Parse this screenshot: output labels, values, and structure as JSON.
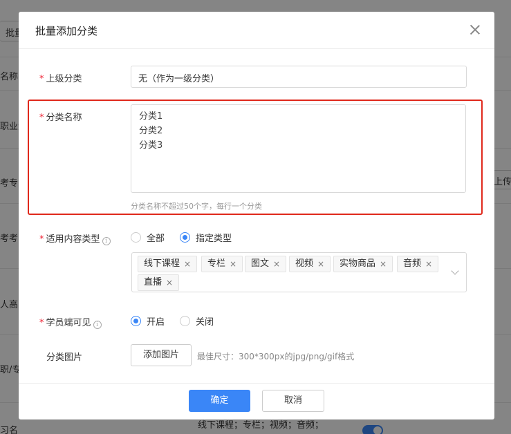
{
  "background": {
    "texts": [
      "批量",
      "名称",
      "职业资",
      "考专",
      "考考",
      "人高",
      "职/专",
      "习名"
    ],
    "right_texts": [
      "上传"
    ],
    "bottom_text": "线下课程；专栏；视频；音频；"
  },
  "modal": {
    "title": "批量添加分类",
    "close_label": "close",
    "parent": {
      "label": "上级分类",
      "value": "无（作为一级分类）"
    },
    "name": {
      "label": "分类名称",
      "value": "分类1\n分类2\n分类3",
      "hint": "分类名称不超过50个字，每行一个分类"
    },
    "content_type": {
      "label": "适用内容类型",
      "options": [
        "全部",
        "指定类型"
      ],
      "selected": "指定类型",
      "tags": [
        "线下课程",
        "专栏",
        "图文",
        "视频",
        "实物商品",
        "音频",
        "直播"
      ]
    },
    "visible": {
      "label": "学员端可见",
      "options": [
        "开启",
        "关闭"
      ],
      "selected": "开启"
    },
    "image": {
      "label": "分类图片",
      "button": "添加图片",
      "tip": "最佳尺寸：300*300px的jpg/png/gif格式"
    },
    "confirm": "确定",
    "cancel": "取消"
  },
  "colors": {
    "accent": "#3a86f7",
    "highlight": "#e0281b",
    "required": "#e02233"
  }
}
